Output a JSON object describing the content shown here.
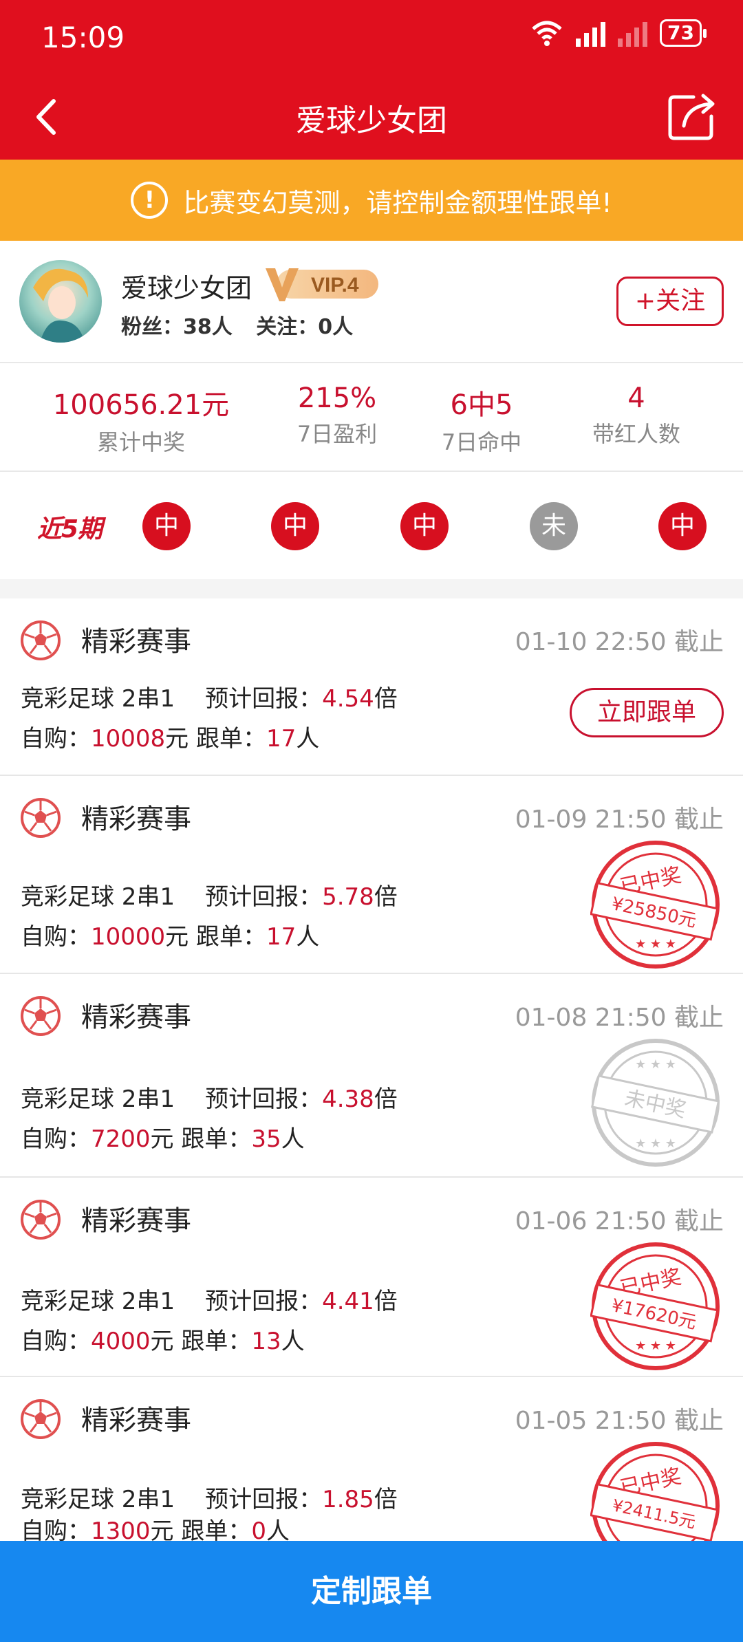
{
  "status_bar": {
    "time": "15:09",
    "battery": "73"
  },
  "nav": {
    "title": "爱球少女团"
  },
  "notice": {
    "text": "比赛变幻莫测，请控制金额理性跟单!"
  },
  "profile": {
    "name": "爱球少女团",
    "vip": "VIP.4",
    "fans_label": "粉丝：",
    "fans": "38人",
    "following_label": "关注：",
    "following": "0人",
    "follow_button": "+关注"
  },
  "stats": [
    {
      "value": "100656.21元",
      "label": "累计中奖"
    },
    {
      "value": "215%",
      "label": "7日盈利"
    },
    {
      "value": "6中5",
      "label": "7日命中"
    },
    {
      "value": "4",
      "label": "带红人数"
    }
  ],
  "recent": {
    "label": "近5期",
    "results": [
      "中",
      "中",
      "中",
      "未",
      "中"
    ]
  },
  "cards": [
    {
      "title": "精彩赛事",
      "date": "01-10 22:50 截止",
      "play": "竞彩足球  2串1",
      "return_label": "预计回报：",
      "return_value": "4.54",
      "return_unit": "倍",
      "self_label": "自购：",
      "self_value": "10008",
      "self_unit": "元",
      "follow_label": "跟单：",
      "follow_value": "17",
      "follow_unit": "人",
      "action": "立即跟单"
    },
    {
      "title": "精彩赛事",
      "date": "01-09 21:50 截止",
      "play": "竞彩足球  2串1",
      "return_label": "预计回报：",
      "return_value": "5.78",
      "return_unit": "倍",
      "self_label": "自购：",
      "self_value": "10000",
      "self_unit": "元",
      "follow_label": "跟单：",
      "follow_value": "17",
      "follow_unit": "人",
      "stamp_title": "已中奖",
      "stamp_amount": "¥25850元"
    },
    {
      "title": "精彩赛事",
      "date": "01-08 21:50 截止",
      "play": "竞彩足球  2串1",
      "return_label": "预计回报：",
      "return_value": "4.38",
      "return_unit": "倍",
      "self_label": "自购：",
      "self_value": "7200",
      "self_unit": "元",
      "follow_label": "跟单：",
      "follow_value": "35",
      "follow_unit": "人",
      "stamp_title": "未中奖"
    },
    {
      "title": "精彩赛事",
      "date": "01-06 21:50 截止",
      "play": "竞彩足球  2串1",
      "return_label": "预计回报：",
      "return_value": "4.41",
      "return_unit": "倍",
      "self_label": "自购：",
      "self_value": "4000",
      "self_unit": "元",
      "follow_label": "跟单：",
      "follow_value": "13",
      "follow_unit": "人",
      "stamp_title": "已中奖",
      "stamp_amount": "¥17620元"
    },
    {
      "title": "精彩赛事",
      "date": "01-05 21:50 截止",
      "play": "竞彩足球  2串1",
      "return_label": "预计回报：",
      "return_value": "1.85",
      "return_unit": "倍",
      "self_label": "自购：",
      "self_value": "1300",
      "self_unit": "元",
      "follow_label": "跟单：",
      "follow_value": "0",
      "follow_unit": "人",
      "stamp_title": "已中奖",
      "stamp_amount": "¥2411.5元"
    }
  ],
  "bottom_button": "定制跟单",
  "colors": {
    "brand_red": "#e00f1e",
    "notice_orange": "#f9a825",
    "bottom_blue": "#1688f0",
    "stamp_red": "#e0303a",
    "stamp_grey": "#c8c8c8"
  }
}
